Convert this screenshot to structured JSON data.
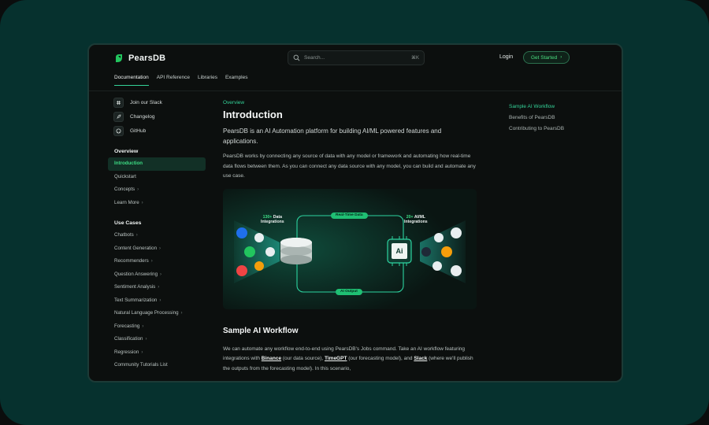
{
  "header": {
    "brand": "PearsDB",
    "search_placeholder": "Search...",
    "search_shortcut": "⌘K",
    "login": "Login",
    "cta": "Get Started"
  },
  "nav": {
    "tabs": [
      {
        "label": "Documentation",
        "active": true
      },
      {
        "label": "API Reference"
      },
      {
        "label": "Libraries"
      },
      {
        "label": "Examples"
      }
    ]
  },
  "sidebar": {
    "links": [
      {
        "label": "Join our Slack",
        "icon": "slack-icon"
      },
      {
        "label": "Changelog",
        "icon": "rocket-icon"
      },
      {
        "label": "GitHub",
        "icon": "github-icon"
      }
    ],
    "overview_title": "Overview",
    "overview_items": [
      {
        "label": "Introduction",
        "active": true
      },
      {
        "label": "Quickstart"
      },
      {
        "label": "Concepts",
        "chevron": true
      },
      {
        "label": "Learn More",
        "chevron": true
      }
    ],
    "usecases_title": "Use Cases",
    "usecase_items": [
      {
        "label": "Chatbots",
        "chevron": true
      },
      {
        "label": "Content Generation",
        "chevron": true
      },
      {
        "label": "Recommenders",
        "chevron": true
      },
      {
        "label": "Question Answering",
        "chevron": true
      },
      {
        "label": "Sentiment Analysis",
        "chevron": true
      },
      {
        "label": "Text Summarization",
        "chevron": true
      },
      {
        "label": "Natural Language Processing",
        "chevron": true
      },
      {
        "label": "Forecasting",
        "chevron": true
      },
      {
        "label": "Classification",
        "chevron": true
      },
      {
        "label": "Regression",
        "chevron": true
      },
      {
        "label": "Community Tutorials List"
      }
    ]
  },
  "main": {
    "eyebrow": "Overview",
    "title": "Introduction",
    "lead": "PearsDB is an AI Automation platform for building AI/ML powered features and applications.",
    "para": "PearsDB works by connecting any source of data with any model or framework and automating how real-time data flows between them. As you can connect any data source with any model, you can build and automate any use case.",
    "diagram": {
      "left_count": "130+",
      "left_label_1": "Data",
      "left_label_2": "Integrations",
      "right_count": "20+",
      "right_label_1": "AI/ML",
      "right_label_2": "Integrations",
      "top_pill": "Real-Time Data",
      "bottom_pill": "AI Output",
      "chip_text": "Ai"
    },
    "section_title": "Sample AI Workflow",
    "section_para_1": "We can automate any workflow end-to-end using PearsDB's Jobs command. Take an AI workflow featuring integrations with ",
    "section_link_1": "Binance",
    "section_para_2": " (our data source), ",
    "section_link_2": "TimeGPT",
    "section_para_3": " (our forecasting model), and ",
    "section_link_3": "Slack",
    "section_para_4": " (where we'll publish the outputs from the forecasting model). In this scenario,"
  },
  "toc": {
    "items": [
      {
        "label": "Sample AI Workflow",
        "active": true
      },
      {
        "label": "Benefits of PearsDB"
      },
      {
        "label": "Contributing to PearsDB"
      }
    ]
  },
  "colors": {
    "accent": "#34d399",
    "background": "#0c0f0e",
    "frame": "#06312e"
  }
}
